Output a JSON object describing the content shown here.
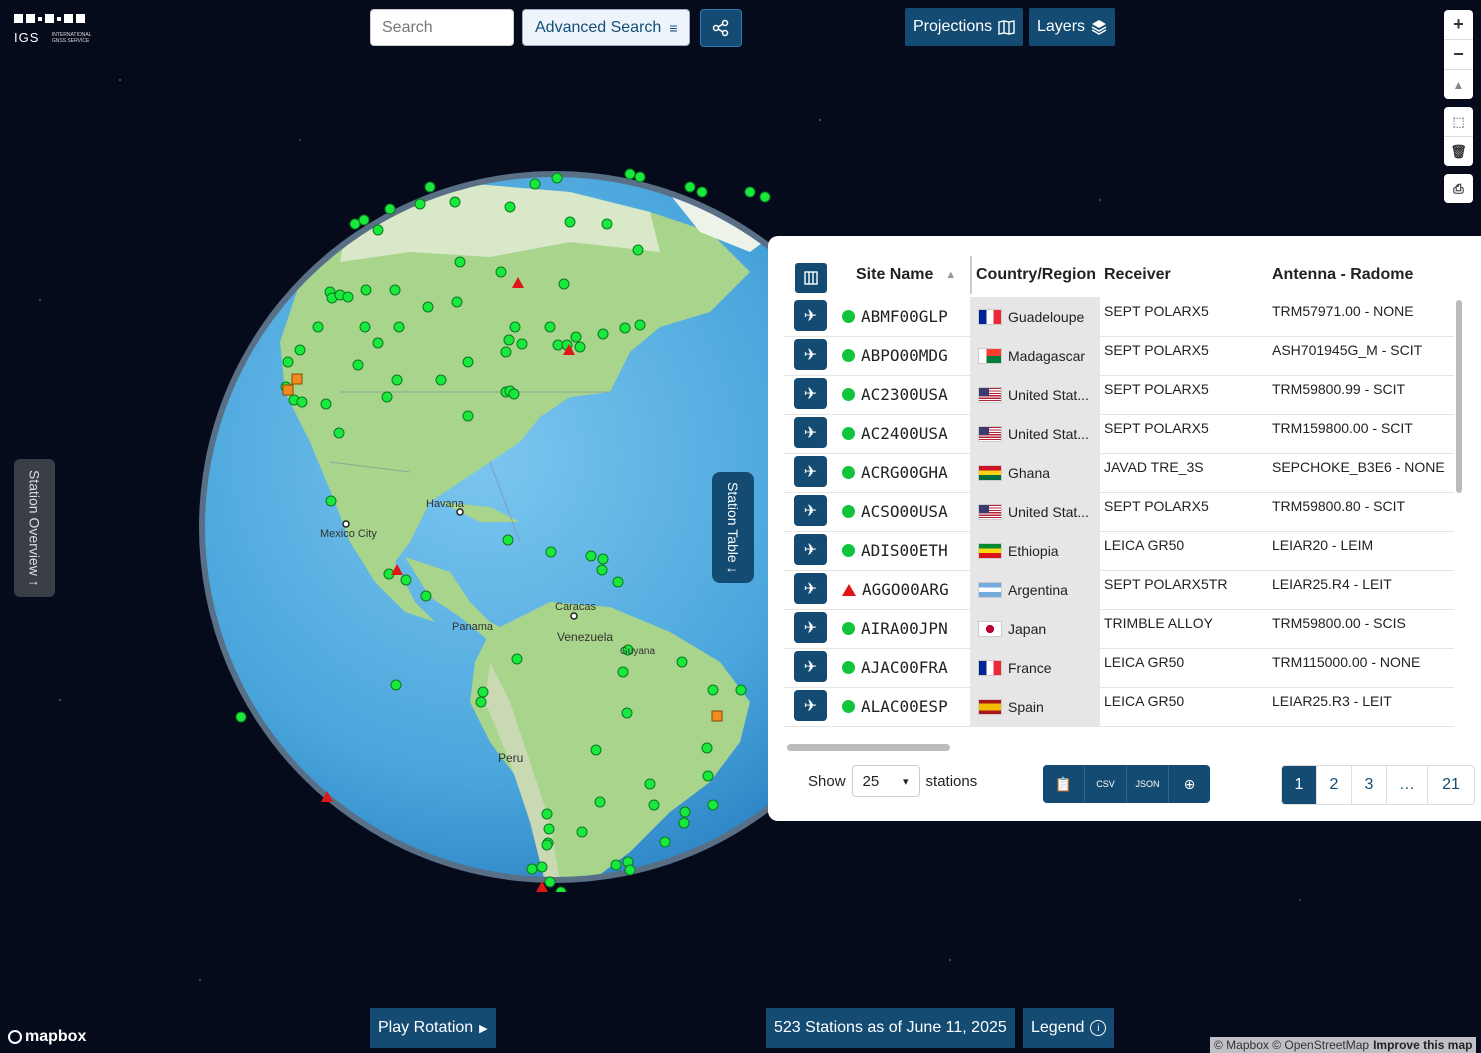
{
  "logo": {
    "name": "IGS",
    "tagline": "INTERNATIONAL GNSS SERVICE"
  },
  "toolbar": {
    "search_placeholder": "Search",
    "advanced_search": "Advanced Search",
    "projections": "Projections",
    "layers": "Layers"
  },
  "map_labels": [
    {
      "text": "Havana"
    },
    {
      "text": "Mexico City"
    },
    {
      "text": "Caracas"
    },
    {
      "text": "Panama"
    },
    {
      "text": "Venezuela"
    },
    {
      "text": "Guyana"
    },
    {
      "text": "Peru"
    }
  ],
  "side_tabs": {
    "overview": "Station Overview ↑",
    "table": "Station Table ↓"
  },
  "table": {
    "columns": [
      "Site Name",
      "Country/Region",
      "Receiver",
      "Antenna - Radome"
    ],
    "rows": [
      {
        "site": "ABMF00GLP",
        "status": "ok",
        "country": "Guadeloupe",
        "flag": "fr",
        "receiver": "SEPT POLARX5",
        "antenna": "TRM57971.00 - NONE"
      },
      {
        "site": "ABPO00MDG",
        "status": "ok",
        "country": "Madagascar",
        "flag": "mg",
        "receiver": "SEPT POLARX5",
        "antenna": "ASH701945G_M - SCIT"
      },
      {
        "site": "AC2300USA",
        "status": "ok",
        "country": "United Stat...",
        "flag": "us",
        "receiver": "SEPT POLARX5",
        "antenna": "TRM59800.99 - SCIT"
      },
      {
        "site": "AC2400USA",
        "status": "ok",
        "country": "United Stat...",
        "flag": "us",
        "receiver": "SEPT POLARX5",
        "antenna": "TRM159800.00 - SCIT"
      },
      {
        "site": "ACRG00GHA",
        "status": "ok",
        "country": "Ghana",
        "flag": "gh",
        "receiver": "JAVAD TRE_3S",
        "antenna": "SEPCHOKE_B3E6 - NONE"
      },
      {
        "site": "ACSO00USA",
        "status": "ok",
        "country": "United Stat...",
        "flag": "us",
        "receiver": "SEPT POLARX5",
        "antenna": "TRM59800.80 - SCIT"
      },
      {
        "site": "ADIS00ETH",
        "status": "ok",
        "country": "Ethiopia",
        "flag": "et",
        "receiver": "LEICA GR50",
        "antenna": "LEIAR20 - LEIM"
      },
      {
        "site": "AGGO00ARG",
        "status": "warn",
        "country": "Argentina",
        "flag": "ar",
        "receiver": "SEPT POLARX5TR",
        "antenna": "LEIAR25.R4 - LEIT"
      },
      {
        "site": "AIRA00JPN",
        "status": "ok",
        "country": "Japan",
        "flag": "jp",
        "receiver": "TRIMBLE ALLOY",
        "antenna": "TRM59800.00 - SCIS"
      },
      {
        "site": "AJAC00FRA",
        "status": "ok",
        "country": "France",
        "flag": "fr",
        "receiver": "LEICA GR50",
        "antenna": "TRM115000.00 - NONE"
      },
      {
        "site": "ALAC00ESP",
        "status": "ok",
        "country": "Spain",
        "flag": "es",
        "receiver": "LEICA GR50",
        "antenna": "LEIAR25.R3 - LEIT"
      }
    ],
    "show_label": "Show",
    "page_size": "25",
    "stations_label": "stations",
    "pages": [
      "1",
      "2",
      "3",
      "…",
      "21"
    ]
  },
  "bottom": {
    "play_rotation": "Play Rotation",
    "stations_count": "523 Stations as of June 11, 2025",
    "legend": "Legend"
  },
  "mapbox_logo": "mapbox",
  "attribution": {
    "text": "© Mapbox © OpenStreetMap",
    "improve": "Improve this map"
  }
}
